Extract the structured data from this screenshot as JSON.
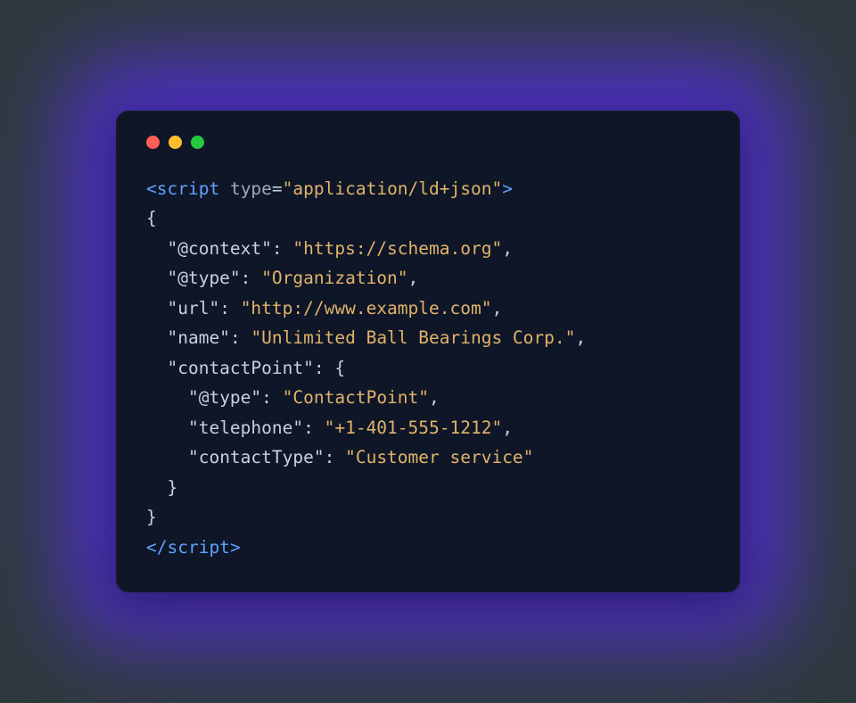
{
  "tag_open_left": "<",
  "tag_name": "script",
  "attr_name": "type",
  "attr_eq": "=",
  "attr_value": "\"application/ld+json\"",
  "tag_open_right": ">",
  "brace_open_1": "{",
  "k_context": "\"@context\"",
  "v_context": "\"https://schema.org\"",
  "k_type": "\"@type\"",
  "v_type": "\"Organization\"",
  "k_url": "\"url\"",
  "v_url": "\"http://www.example.com\"",
  "k_name": "\"name\"",
  "v_name": "\"Unlimited Ball Bearings Corp.\"",
  "k_contactPoint": "\"contactPoint\"",
  "brace_open_2": "{",
  "k_cp_type": "\"@type\"",
  "v_cp_type": "\"ContactPoint\"",
  "k_telephone": "\"telephone\"",
  "v_telephone": "\"+1-401-555-1212\"",
  "k_contactType": "\"contactType\"",
  "v_contactType": "\"Customer service\"",
  "brace_close_2": "}",
  "brace_close_1": "}",
  "tag_close_left": "</",
  "tag_close_right": ">",
  "colon": ":",
  "comma": ",",
  "sp": " "
}
